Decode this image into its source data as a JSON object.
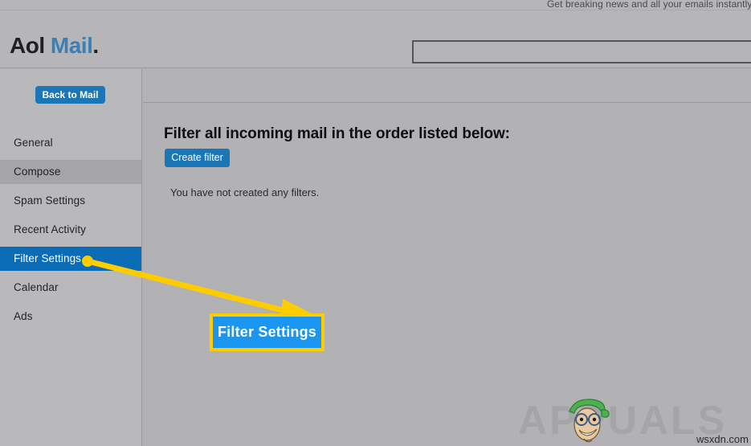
{
  "promo": {
    "text": "Get breaking news and all your emails instantly."
  },
  "header": {
    "logo_aol": "Aol",
    "logo_mail": "Mail",
    "logo_dot": ".",
    "search_value": "",
    "search_placeholder": ""
  },
  "sidebar": {
    "back_to_mail_label": "Back to Mail",
    "items": [
      {
        "label": "General",
        "state": "normal"
      },
      {
        "label": "Compose",
        "state": "hovered"
      },
      {
        "label": "Spam Settings",
        "state": "normal"
      },
      {
        "label": "Recent Activity",
        "state": "normal"
      },
      {
        "label": "Filter Settings",
        "state": "selected"
      },
      {
        "label": "Calendar",
        "state": "normal"
      },
      {
        "label": "Ads",
        "state": "normal"
      }
    ]
  },
  "main": {
    "heading": "Filter all incoming mail in the order listed below:",
    "create_filter_label": "Create filter",
    "empty_message": "You have not created any filters."
  },
  "annotation": {
    "callout_label": "Filter Settings",
    "highlight_color": "#ffcc00",
    "callout_fill": "#1a96f0",
    "arrow_color": "#ffcc00"
  },
  "watermark": {
    "brand": "APPUALS",
    "url": "wsxdn.com"
  },
  "colors": {
    "page_background": "#b2b2b4",
    "accent_blue": "#1a76b5",
    "selected_blue": "#0a6cb4",
    "brand_blue": "#3b7fb5"
  }
}
